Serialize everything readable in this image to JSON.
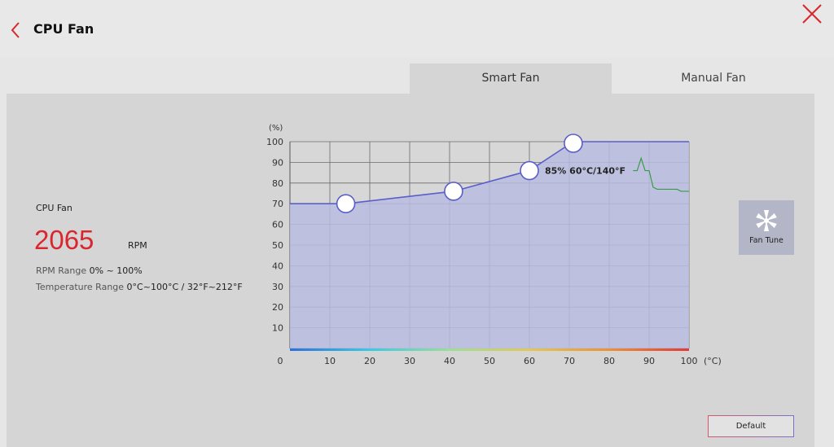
{
  "window": {
    "title": "CPU Fan"
  },
  "tabs": [
    {
      "label": "Smart Fan",
      "active": true
    },
    {
      "label": "Manual Fan",
      "active": false
    }
  ],
  "fan_info": {
    "name": "CPU Fan",
    "rpm": "2065",
    "rpm_unit": "RPM",
    "rpm_range_label": "RPM Range",
    "rpm_range_value": "0% ~ 100%",
    "temp_range_label": "Temperature Range",
    "temp_range_value": "0°C~100°C / 32°F~212°F"
  },
  "chart_data": {
    "type": "line",
    "y_unit": "(%)",
    "x_unit": "(°C)",
    "xlim": [
      0,
      100
    ],
    "ylim": [
      0,
      100
    ],
    "x_ticks": [
      "0",
      "10",
      "20",
      "30",
      "40",
      "50",
      "60",
      "70",
      "80",
      "90",
      "100"
    ],
    "y_ticks": [
      "10",
      "20",
      "30",
      "40",
      "50",
      "60",
      "70",
      "80",
      "90",
      "100"
    ],
    "grid": true,
    "fan_curve": [
      {
        "x": 0,
        "y": 70
      },
      {
        "x": 14,
        "y": 70,
        "handle": true
      },
      {
        "x": 41,
        "y": 76,
        "handle": true
      },
      {
        "x": 60,
        "y": 86,
        "handle": true
      },
      {
        "x": 71,
        "y": 101,
        "handle": true
      },
      {
        "x": 100,
        "y": 101
      }
    ],
    "temp_history": [
      {
        "x": 86,
        "y": 86
      },
      {
        "x": 87,
        "y": 86
      },
      {
        "x": 88,
        "y": 92
      },
      {
        "x": 89,
        "y": 86
      },
      {
        "x": 90,
        "y": 86
      },
      {
        "x": 91,
        "y": 78
      },
      {
        "x": 92,
        "y": 77
      },
      {
        "x": 97,
        "y": 77
      },
      {
        "x": 98,
        "y": 76
      },
      {
        "x": 100,
        "y": 76
      }
    ],
    "annotation": {
      "text": "85% 60°C/140°F",
      "x": 60,
      "y": 86
    },
    "fill_color": "#b9bde0",
    "curve_color": "#5a5ec8",
    "history_color": "#3a9a4a"
  },
  "fan_tune": {
    "label": "Fan Tune",
    "icon": "fan-icon"
  },
  "default_button": {
    "label": "Default"
  },
  "colors": {
    "accent": "#d9262f",
    "panel": "#d5d5d5"
  }
}
